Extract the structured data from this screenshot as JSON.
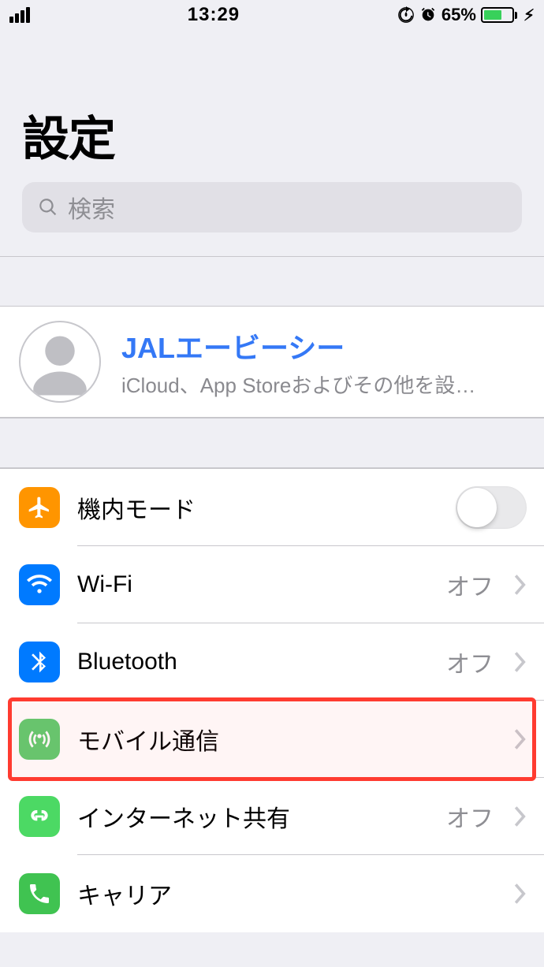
{
  "statusbar": {
    "time": "13:29",
    "battery_percent": "65%"
  },
  "header": {
    "title": "設定"
  },
  "search": {
    "placeholder": "検索"
  },
  "profile": {
    "name": "JALエービーシー",
    "subtitle": "iCloud、App Storeおよびその他を設…"
  },
  "rows": {
    "airplane": {
      "label": "機内モード"
    },
    "wifi": {
      "label": "Wi-Fi",
      "value": "オフ"
    },
    "bluetooth": {
      "label": "Bluetooth",
      "value": "オフ"
    },
    "cellular": {
      "label": "モバイル通信"
    },
    "hotspot": {
      "label": "インターネット共有",
      "value": "オフ"
    },
    "carrier": {
      "label": "キャリア"
    }
  }
}
